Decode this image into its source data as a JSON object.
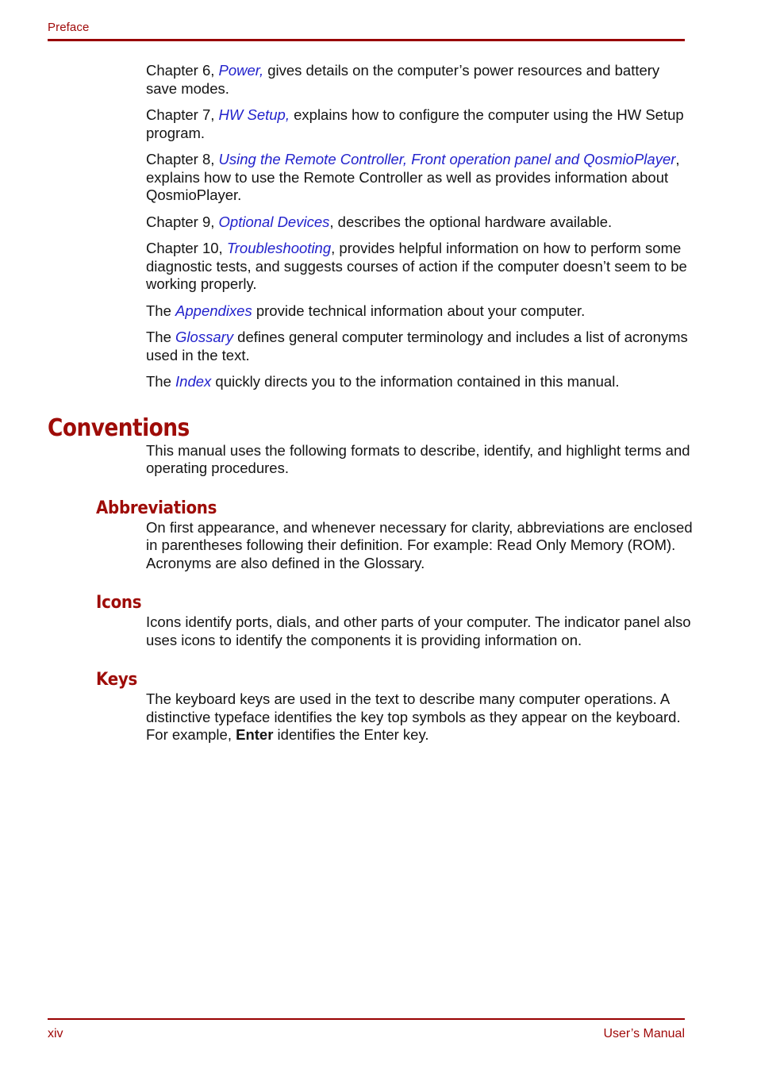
{
  "header": {
    "label": "Preface"
  },
  "intro_paragraphs": [
    {
      "id": "chapter-6",
      "lead": "Chapter 6, ",
      "link": "Power,",
      "tail": " gives details on the computer’s power resources and battery save modes."
    },
    {
      "id": "chapter-7",
      "lead": "Chapter 7, ",
      "link": "HW Setup,",
      "tail": " explains how to configure the computer using the HW Setup program."
    },
    {
      "id": "chapter-8",
      "lead": "Chapter 8, ",
      "link": "Using the Remote Controller, Front operation panel and QosmioPlayer",
      "tail": ", explains how to use the Remote Controller as well as provides information about QosmioPlayer."
    },
    {
      "id": "chapter-9",
      "lead": "Chapter 9, ",
      "link": "Optional Devices",
      "tail": ", describes the optional hardware available."
    },
    {
      "id": "chapter-10",
      "lead": "Chapter 10, ",
      "link": "Troubleshooting",
      "tail": ", provides helpful information on how to perform some diagnostic tests, and suggests courses of action if the computer doesn’t seem to be working properly."
    },
    {
      "id": "appendixes",
      "lead": "The ",
      "link": "Appendixes",
      "tail": " provide technical information about your computer."
    },
    {
      "id": "glossary",
      "lead": "The ",
      "link": "Glossary",
      "tail": " defines general computer terminology and includes a list of acronyms used in the text."
    },
    {
      "id": "index",
      "lead": "The ",
      "link": "Index",
      "tail": " quickly directs you to the information contained in this manual."
    }
  ],
  "conventions": {
    "title": "Conventions",
    "intro": "This manual uses the following formats to describe, identify, and highlight terms and operating procedures.",
    "abbreviations": {
      "title": "Abbreviations",
      "text": "On first appearance, and whenever necessary for clarity, abbreviations are enclosed in parentheses following their definition. For example: Read Only Memory (ROM). Acronyms are also defined in the Glossary."
    },
    "icons": {
      "title": "Icons",
      "text": "Icons identify ports, dials, and other parts of your computer. The indicator panel also uses icons to identify the components it is providing information on."
    },
    "keys": {
      "title": "Keys",
      "lead": "The keyboard keys are used in the text to describe many computer operations. A distinctive typeface identifies the key top symbols as they appear on the keyboard. For example, ",
      "bold": "Enter",
      "tail": " identifies the Enter key."
    }
  },
  "footer": {
    "page_number": "xiv",
    "manual_label": "User’s Manual"
  },
  "colors": {
    "heading_red": "#9E0C08",
    "rule_red": "#990000",
    "link_blue": "#2222CC"
  }
}
